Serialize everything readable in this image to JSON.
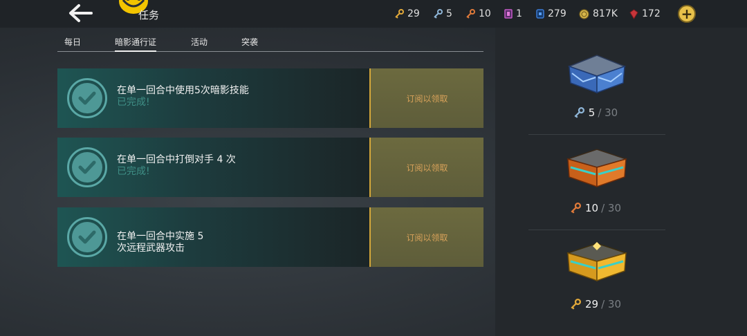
{
  "header": {
    "title": "任务",
    "resources": [
      {
        "icon": "gold-key-icon",
        "value": "29",
        "color": "#e2a93a"
      },
      {
        "icon": "blue-key-icon",
        "value": "5",
        "color": "#8fb6d8"
      },
      {
        "icon": "orange-key-icon",
        "value": "10",
        "color": "#e07a3a"
      },
      {
        "icon": "ticket-icon",
        "value": "1",
        "color": "#c45ac7"
      },
      {
        "icon": "card-icon",
        "value": "279",
        "color": "#3a7bd6"
      },
      {
        "icon": "coin-icon",
        "value": "817K",
        "color": "#d6b64a"
      },
      {
        "icon": "gem-icon",
        "value": "172",
        "color": "#c8353a"
      }
    ],
    "plus": "+"
  },
  "tabs": [
    "每日",
    "暗影通行证",
    "活动",
    "突袭"
  ],
  "active_tab": 1,
  "quests": [
    {
      "text": "在单一回合中使用5次暗影技能",
      "status": "已完成!",
      "claim": "订阅以领取"
    },
    {
      "text": "在单一回合中打倒对手 4 次",
      "status": "已完成!",
      "claim": "订阅以领取"
    },
    {
      "text": "在单一回合中实施 5\n次远程武器攻击",
      "status": "",
      "claim": "订阅以领取"
    }
  ],
  "chests": [
    {
      "name": "blue-chest",
      "count": "5",
      "max": "/ 30",
      "key_icon": "blue-key-icon"
    },
    {
      "name": "orange-chest",
      "count": "10",
      "max": "/ 30",
      "key_icon": "orange-key-icon"
    },
    {
      "name": "gold-chest",
      "count": "29",
      "max": "/ 30",
      "key_icon": "gold-key-icon"
    }
  ]
}
